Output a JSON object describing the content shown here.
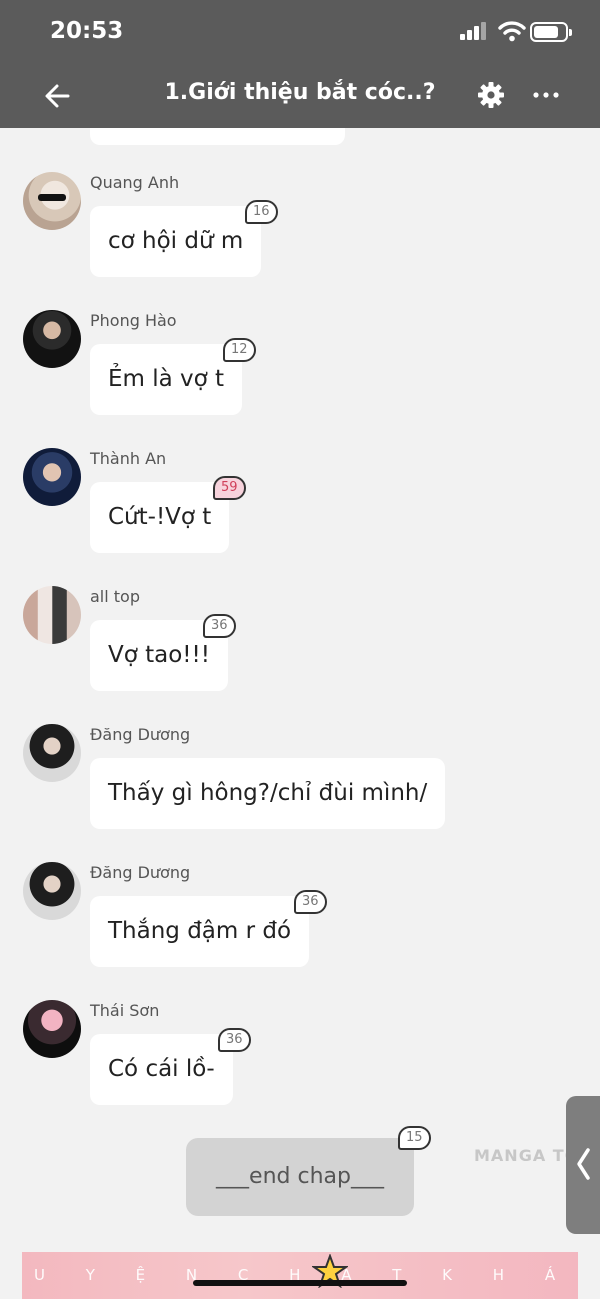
{
  "status_bar": {
    "time": "20:53"
  },
  "header": {
    "title": "1.Giới thiệu bắt cóc..?"
  },
  "messages": [
    {
      "sender": "Quang Anh",
      "text": "cơ hội dữ m",
      "badge": "16"
    },
    {
      "sender": "Phong Hào",
      "text": "Ẻm là vợ t",
      "badge": "12"
    },
    {
      "sender": "Thành An",
      "text": "Cứt-!Vợ t",
      "badge": "59"
    },
    {
      "sender": "all top",
      "text": "Vợ tao!!!",
      "badge": "36"
    },
    {
      "sender": "Đăng Dương",
      "text": "Thấy gì hông?/chỉ đùi mình/",
      "badge": ""
    },
    {
      "sender": "Đăng Dương",
      "text": "Thắng đậm r đó",
      "badge": "36"
    },
    {
      "sender": "Thái Sơn",
      "text": "Có cái lồ-",
      "badge": "36"
    }
  ],
  "end_message": {
    "text": "___end chap___",
    "badge": "15"
  },
  "watermark": "MANGA TO",
  "banner": {
    "text": "U Y Ệ N  C H A T  K H Á M  P H Á"
  },
  "colors": {
    "header_bg": "#5b5b5b",
    "page_bg": "#f2f2f2",
    "bubble_bg": "#ffffff",
    "end_bubble_bg": "#d3d3d3",
    "badge_highlight": "#f7d3dc"
  },
  "icons": {
    "back": "arrow-left-icon",
    "settings": "gear-icon",
    "more": "more-dots-icon",
    "side_tab": "chevron-left-icon"
  }
}
